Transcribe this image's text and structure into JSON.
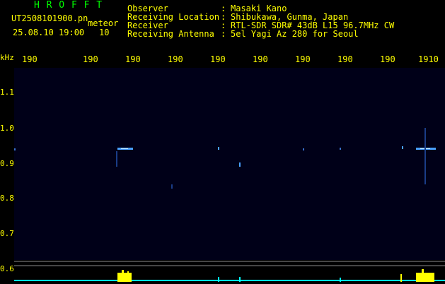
{
  "header": {
    "app_title": "H R O F F T",
    "filename": "UT2508101900.pn",
    "meteor_label": "meteor",
    "datetime": "25.08.10 19:00",
    "meteor_count": "10",
    "fields": [
      {
        "label": "Observer",
        "sep": ":",
        "value": "Masaki Kano"
      },
      {
        "label": "Receiving Location",
        "sep": ":",
        "value": "Shibukawa, Gunma, Japan"
      },
      {
        "label": "Receiver",
        "sep": ":",
        "value": "RTL-SDR SDR# 43dB L15 96.7MHz CW"
      },
      {
        "label": "Receiving Antenna",
        "sep": ":",
        "value": "5el Yagi Az 280 for Seoul"
      }
    ]
  },
  "time_axis": {
    "labels": [
      "190",
      "190",
      "190",
      "190",
      "190",
      "190",
      "190",
      "190",
      "190",
      "1910"
    ]
  },
  "freq_axis": {
    "unit": "kHz",
    "labels": [
      "1.1",
      "1.0",
      "0.9",
      "0.8",
      "0.7",
      "0.6"
    ]
  },
  "colors": {
    "text": "#ffff00",
    "title": "#00ff00",
    "background": "#000000",
    "spectrogram_bg": "#000018",
    "signal": "#4aa0ff",
    "signal_bright": "#c8e8ff",
    "power_line": "#00ffff",
    "burst": "#ffff00",
    "grid_line": "#8a8a8a"
  }
}
